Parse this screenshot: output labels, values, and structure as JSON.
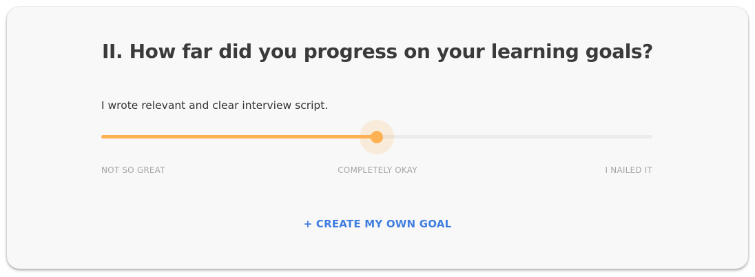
{
  "section": {
    "title": "II. How far did you progress on your learning goals?"
  },
  "goal": {
    "text": "I wrote relevant and clear interview script.",
    "progress_fraction": 0.5
  },
  "scale": {
    "low_label": "NOT SO GREAT",
    "mid_label": "COMPLETELY OKAY",
    "high_label": "I NAILED IT"
  },
  "actions": {
    "create_goal_label": "+ CREATE MY OWN GOAL"
  },
  "colors": {
    "accent": "#fdb153",
    "link": "#3f7de0",
    "track": "#ebebeb"
  }
}
